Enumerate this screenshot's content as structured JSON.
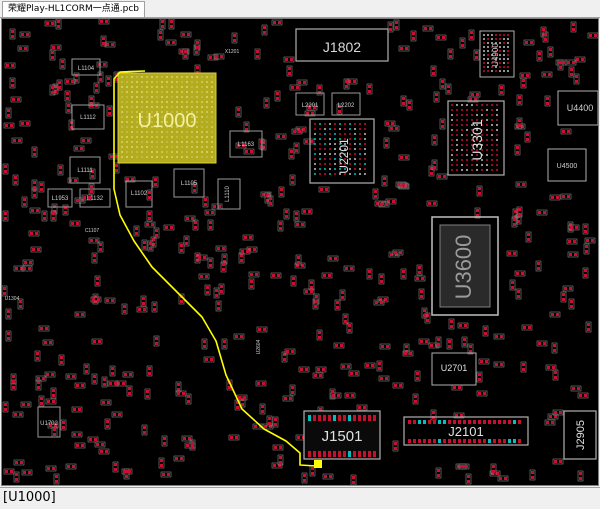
{
  "window": {
    "tab_title": "荣耀Play-HL1CORM一点通.pcb"
  },
  "status_bar": {
    "selection": "[U1000]"
  },
  "colors": {
    "board": "#000000",
    "pad_red": "#c8102e",
    "outline": "#b0b0b0",
    "highlight": "#b8b020",
    "trace": "#ffff00",
    "via_cyan": "#00c0c0"
  },
  "components": {
    "u1000": "U1000",
    "j1802": "J1802",
    "u2201": "U2201",
    "u3301": "U3301",
    "u3600": "U3600",
    "j1501": "J1501",
    "j2101": "J2101",
    "j2905": "J2905",
    "u2701": "U2701",
    "u4900": "U4900",
    "u4400": "U4400",
    "u4500": "U4500",
    "l1104": "L1104",
    "l1112": "L1112",
    "l1111": "L1111",
    "l1102": "L1102",
    "l1105": "L1105",
    "l1110": "L1110",
    "l1163": "L1163",
    "l1953": "L1953",
    "l1132": "L1132",
    "c1107": "C1107",
    "l2201": "L2201",
    "l2202": "L2202",
    "x1201": "X1201",
    "u1702": "U1702",
    "u1304": "U1304",
    "u2604": "U2604"
  }
}
